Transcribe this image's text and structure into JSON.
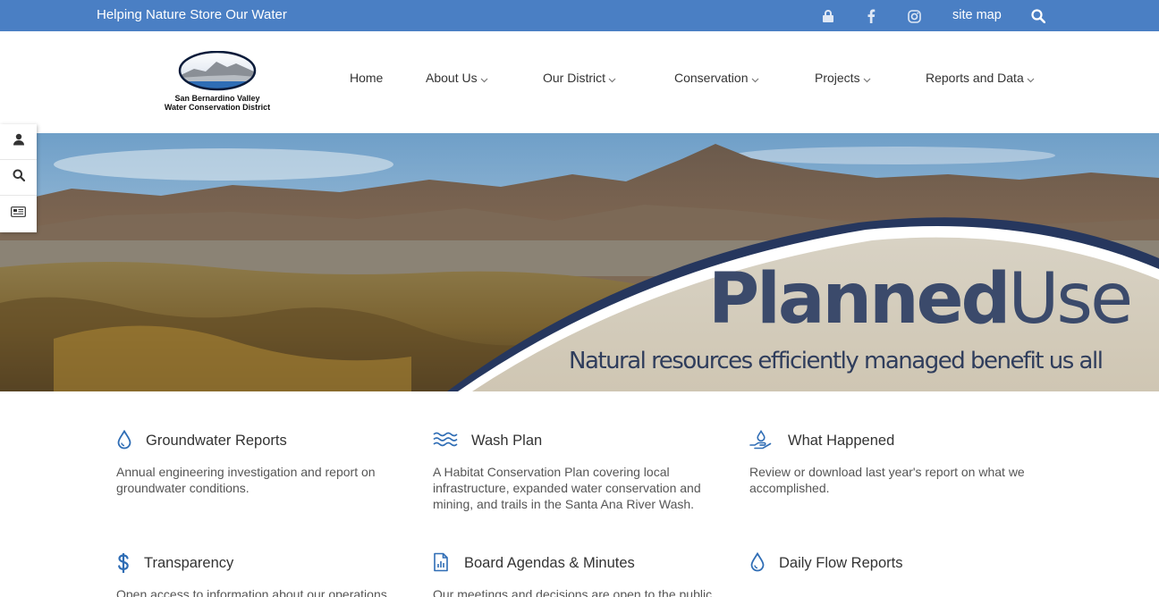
{
  "colors": {
    "topbar": "#4a7fc4",
    "accent_blue": "#2f6db5",
    "text": "#333333",
    "muted": "#555555"
  },
  "topbar": {
    "tagline": "Helping Nature Store Our Water",
    "icons": [
      "lock-icon",
      "facebook-icon",
      "instagram-icon",
      "search-icon"
    ],
    "sitemap_label": "site map"
  },
  "logo": {
    "line1": "San Bernardino Valley",
    "line2": "Water Conservation District"
  },
  "nav": {
    "home": "Home",
    "about": "About Us",
    "district": "Our District",
    "conservation": "Conservation",
    "projects": "Projects",
    "reports": "Reports and Data"
  },
  "side_tools": [
    "user-icon",
    "search-icon",
    "news-icon"
  ],
  "hero": {
    "headline_bold": "Planned",
    "headline_light": "Use",
    "tagline": "Natural resources efficiently managed benefit us all"
  },
  "features": [
    {
      "title": "Groundwater Reports",
      "icon": "water-drop-icon",
      "desc": "Annual engineering investigation and report on groundwater conditions."
    },
    {
      "title": "Wash Plan",
      "icon": "waves-icon",
      "desc": "A Habitat Conservation Plan covering local infrastructure, expanded water conservation and mining, and trails in the Santa Ana River Wash."
    },
    {
      "title": "What Happened",
      "icon": "hand-water-icon",
      "desc": "Review or download last year's report on what we accomplished."
    },
    {
      "title": "Transparency",
      "icon": "dollar-icon",
      "desc": "Open access to information about our operations"
    },
    {
      "title": "Board Agendas & Minutes",
      "icon": "document-chart-icon",
      "desc": "Our meetings and decisions are open to the public."
    },
    {
      "title": "Daily Flow Reports",
      "icon": "water-drop-icon",
      "desc": ""
    }
  ]
}
